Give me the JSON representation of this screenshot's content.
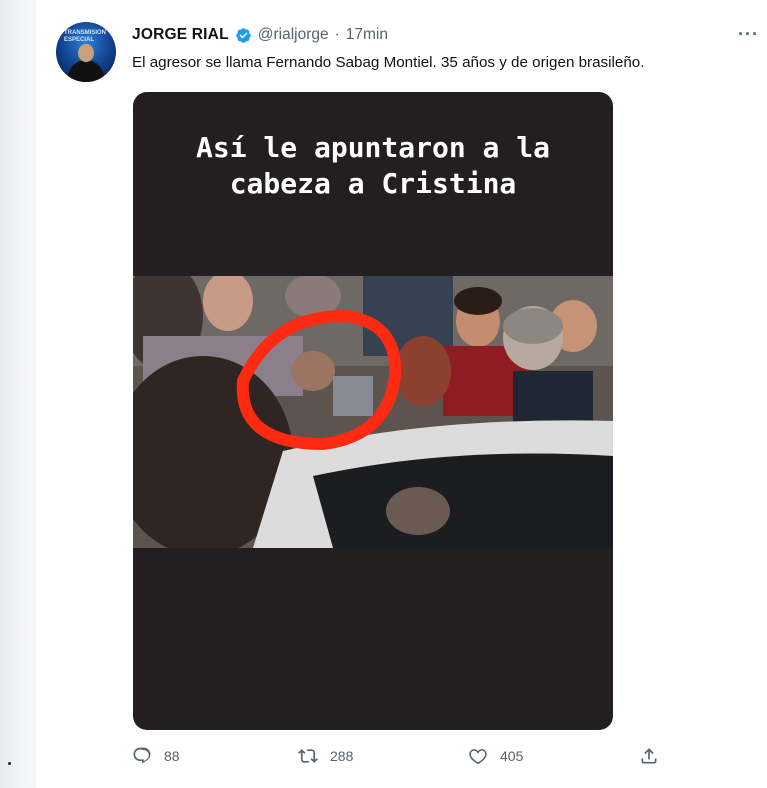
{
  "tweet": {
    "author_name": "JORGE RIAL",
    "handle": "@rialjorge",
    "separator": "·",
    "time": "17min",
    "more": "···",
    "text": "El agresor se llama Fernando Sabag Montiel. 35 años y de origen brasileño.",
    "avatar_text": "TRANSMISION ESPECIAL",
    "media_caption": "Así le apuntaron a la\ncabeza a Cristina",
    "actions": {
      "replies": "88",
      "retweets": "288",
      "likes": "405"
    }
  },
  "colors": {
    "accent": "#1d9bf0",
    "secondary_text": "#536471",
    "media_bg": "#231f20",
    "highlight_circle": "#ff2a12"
  }
}
